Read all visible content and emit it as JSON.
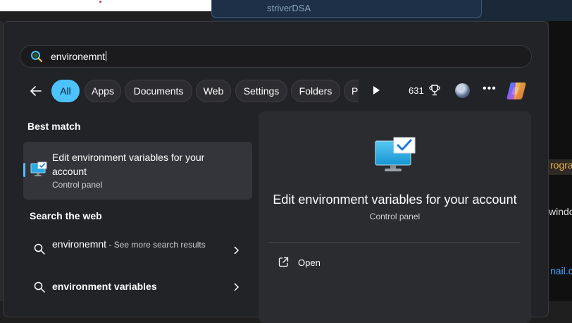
{
  "background": {
    "tab_text": "striverDSA",
    "right_texts": [
      "rogra",
      "windo",
      "nail.co"
    ]
  },
  "search": {
    "value": "environemnt"
  },
  "filters": {
    "chips": [
      "All",
      "Apps",
      "Documents",
      "Web",
      "Settings",
      "Folders",
      "Ph"
    ],
    "active": "All",
    "points": "631"
  },
  "best_match": {
    "heading": "Best match",
    "title": "Edit environment variables for your account",
    "subtitle": "Control panel"
  },
  "web": {
    "heading": "Search the web",
    "items": [
      {
        "query": "environemnt",
        "suffix": " - See more search results"
      },
      {
        "query": "environment variables",
        "suffix": ""
      }
    ]
  },
  "preview": {
    "title": "Edit environment variables for your account",
    "subtitle": "Control panel",
    "action_open": "Open"
  },
  "colors": {
    "accent": "#4cc2ff",
    "panel": "#222327",
    "preview": "#2b2c30",
    "best_bg": "#34353a"
  }
}
